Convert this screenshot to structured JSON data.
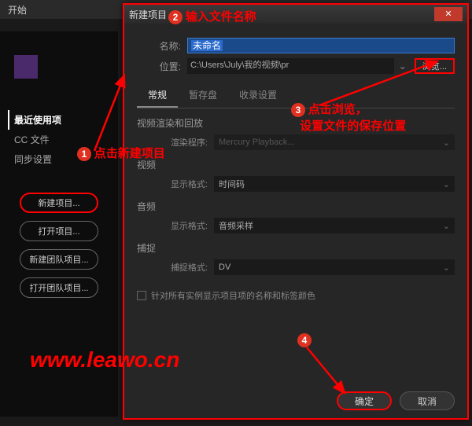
{
  "menubar": {
    "start": "开始"
  },
  "sidebar": {
    "items": [
      {
        "label": "最近使用项",
        "active": true
      },
      {
        "label": "CC 文件"
      },
      {
        "label": "同步设置"
      }
    ],
    "buttons": [
      {
        "label": "新建项目..."
      },
      {
        "label": "打开项目..."
      },
      {
        "label": "新建团队项目..."
      },
      {
        "label": "打开团队项目..."
      }
    ]
  },
  "dialog": {
    "title": "新建项目",
    "name_label": "名称:",
    "name_value": "未命名",
    "loc_label": "位置:",
    "loc_value": "C:\\Users\\July\\我的视频\\pr",
    "browse": "浏览...",
    "tabs": [
      "常规",
      "暂存盘",
      "收录设置"
    ],
    "sections": {
      "render": {
        "title": "视频渲染和回放",
        "label": "渲染程序:",
        "value": "Mercury Playback..."
      },
      "video": {
        "title": "视频",
        "label": "显示格式:",
        "value": "时间码"
      },
      "audio": {
        "title": "音频",
        "label": "显示格式:",
        "value": "音频采样"
      },
      "capture": {
        "title": "捕捉",
        "label": "捕捉格式:",
        "value": "DV"
      }
    },
    "checkbox": "针对所有实例显示项目项的名称和标签颜色",
    "ok": "确定",
    "cancel": "取消"
  },
  "annotations": {
    "a1": "点击新建项目",
    "a2": "输入文件名称",
    "a3a": "点击浏览，",
    "a3b": "设置文件的保存位置",
    "watermark": "www.leawo.cn"
  }
}
